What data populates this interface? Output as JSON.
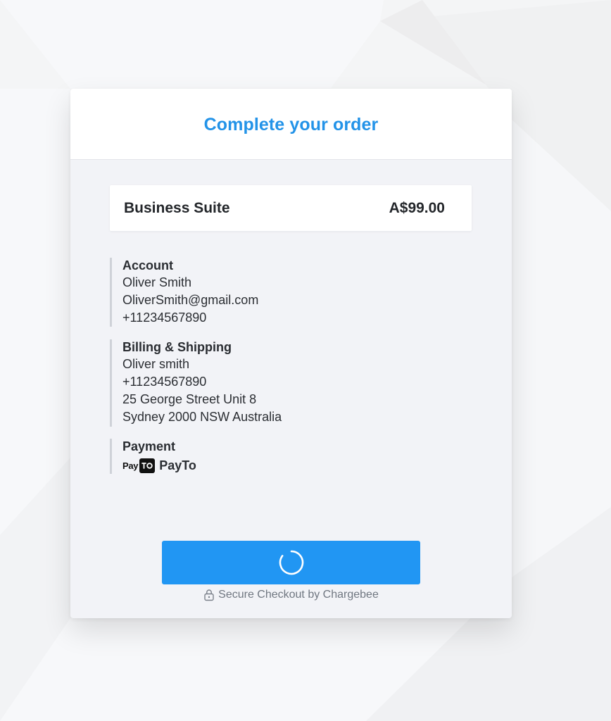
{
  "checkout": {
    "title": "Complete your order",
    "product": {
      "name": "Business Suite",
      "price": "A$99.00"
    },
    "account": {
      "title": "Account",
      "name": "Oliver Smith",
      "email": "OliverSmith@gmail.com",
      "phone": "+11234567890"
    },
    "billing": {
      "title": "Billing & Shipping",
      "name": "Oliver smith",
      "phone": "+11234567890",
      "address_line1": "25 George Street Unit 8",
      "address_line2": "Sydney 2000 NSW Australia"
    },
    "payment": {
      "title": "Payment",
      "method_logo_text": "Pay",
      "method_label": "PayTo"
    },
    "button": {
      "state": "loading",
      "icon": "loading-spinner-icon"
    },
    "secure_text": "Secure Checkout by Chargebee",
    "secure_icon": "lock-icon",
    "colors": {
      "accent": "#2393e8",
      "button": "#2196f3",
      "panel": "#f2f3f7"
    }
  }
}
